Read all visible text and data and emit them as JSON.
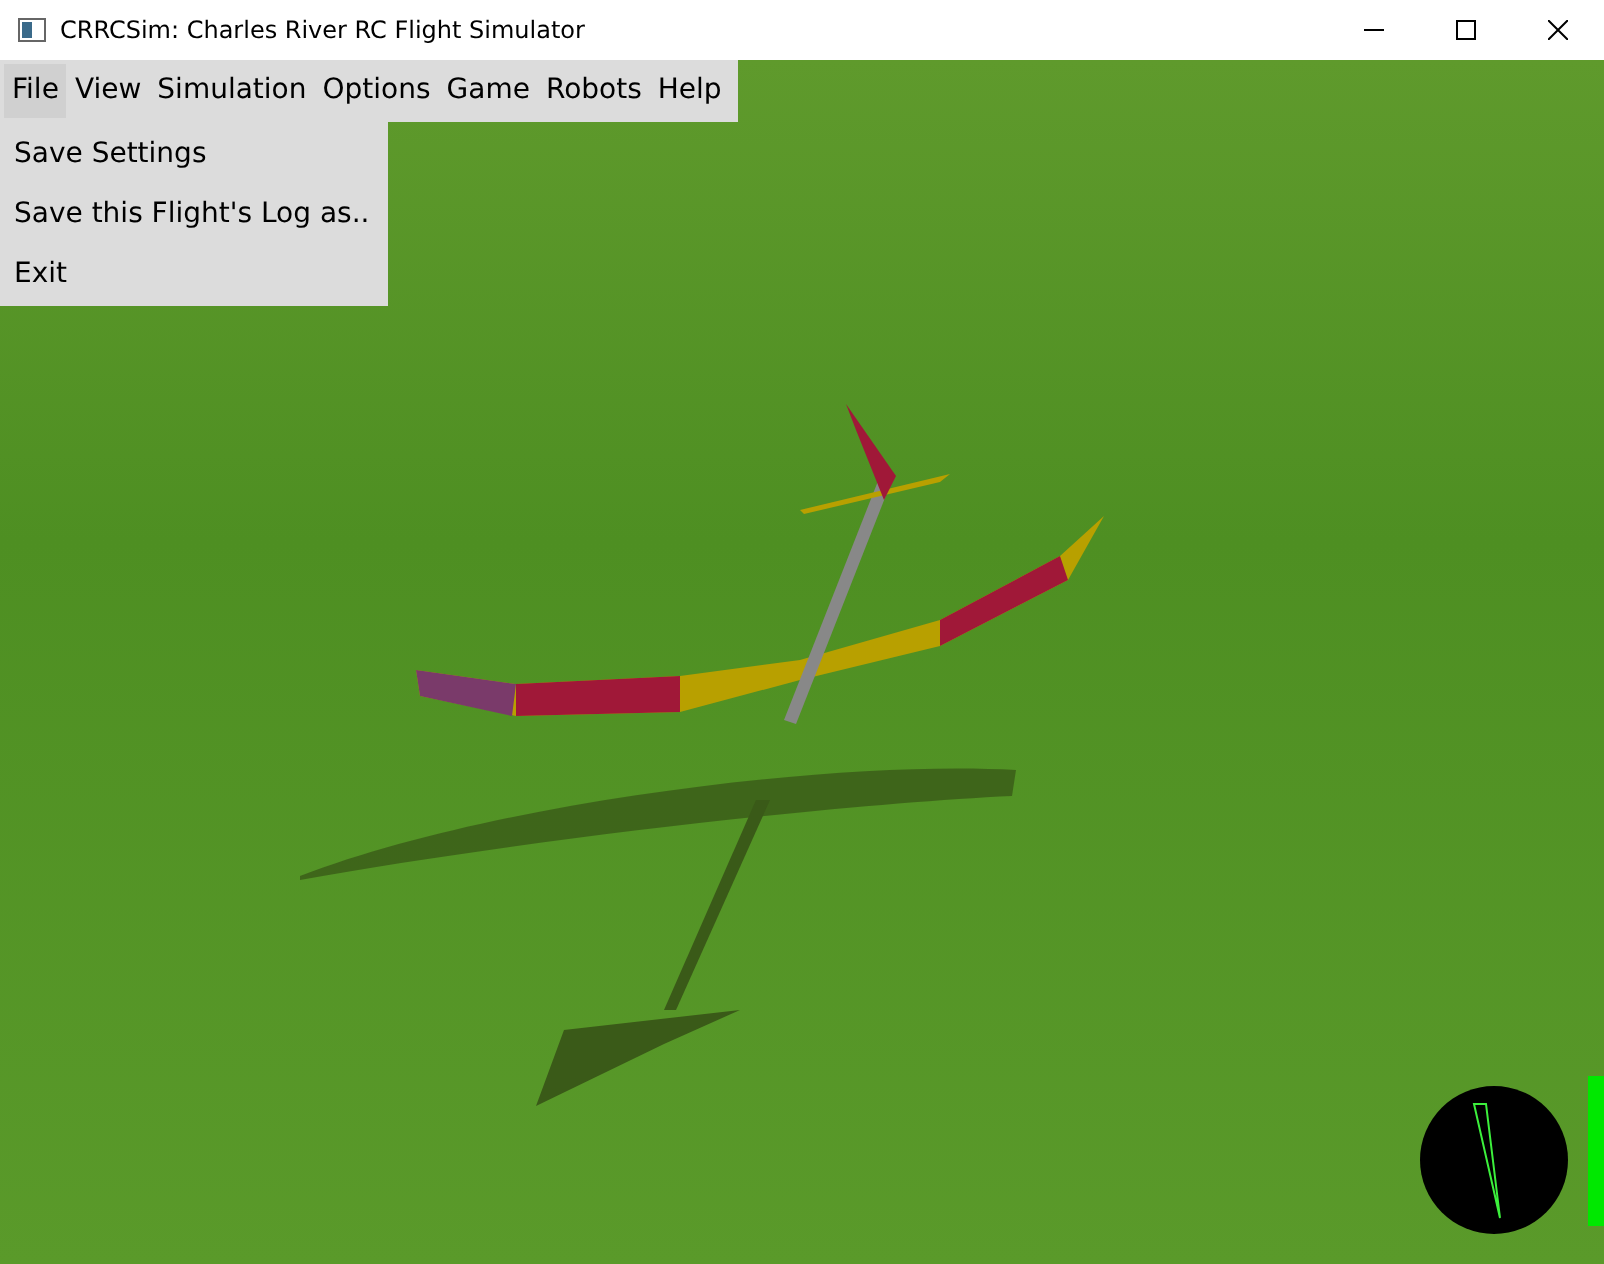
{
  "window": {
    "title": "CRRCSim: Charles River RC Flight Simulator"
  },
  "menu_bar": [
    {
      "label": "File",
      "open": true
    },
    {
      "label": "View",
      "open": false
    },
    {
      "label": "Simulation",
      "open": false
    },
    {
      "label": "Options",
      "open": false
    },
    {
      "label": "Game",
      "open": false
    },
    {
      "label": "Robots",
      "open": false
    },
    {
      "label": "Help",
      "open": false
    }
  ],
  "file_menu": [
    "Save Settings",
    "Save this Flight's Log as..",
    "Exit"
  ]
}
